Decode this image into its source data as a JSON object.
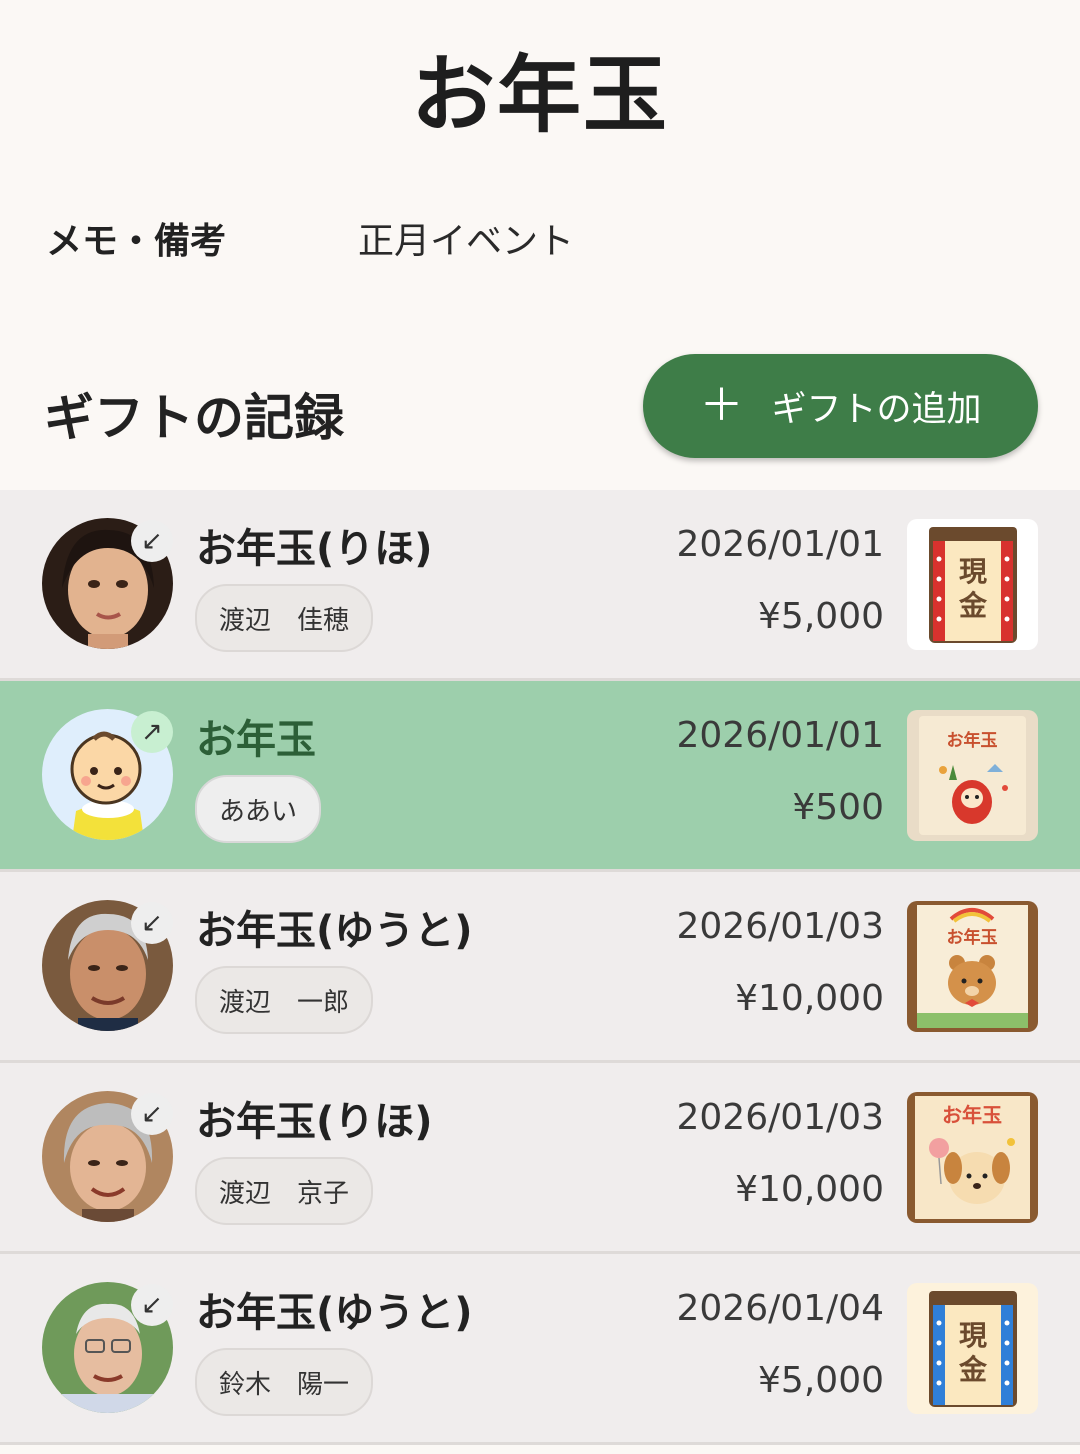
{
  "header": {
    "title": "お年玉"
  },
  "memo": {
    "label": "メモ・備考",
    "value": "正月イベント"
  },
  "gifts_section": {
    "title": "ギフトの記録",
    "add_button": {
      "icon": "plus-icon",
      "label": "ギフトの追加"
    }
  },
  "gifts": [
    {
      "title": "お年玉(りほ)",
      "person": "渡辺　佳穂",
      "date": "2026/01/01",
      "amount": "¥5,000",
      "direction": "received",
      "direction_icon": "↙",
      "selected": false,
      "thumb": "現金 envelope red"
    },
    {
      "title": "お年玉",
      "person": "ああい",
      "date": "2026/01/01",
      "amount": "¥500",
      "direction": "given",
      "direction_icon": "↗",
      "selected": true,
      "thumb": "お年玉 daruma envelope"
    },
    {
      "title": "お年玉(ゆうと)",
      "person": "渡辺　一郎",
      "date": "2026/01/03",
      "amount": "¥10,000",
      "direction": "received",
      "direction_icon": "↙",
      "selected": false,
      "thumb": "お年玉 bear envelope"
    },
    {
      "title": "お年玉(りほ)",
      "person": "渡辺　京子",
      "date": "2026/01/03",
      "amount": "¥10,000",
      "direction": "received",
      "direction_icon": "↙",
      "selected": false,
      "thumb": "お年玉 dog envelope"
    },
    {
      "title": "お年玉(ゆうと)",
      "person": "鈴木　陽一",
      "date": "2026/01/04",
      "amount": "¥5,000",
      "direction": "received",
      "direction_icon": "↙",
      "selected": false,
      "thumb": "現金 envelope blue"
    }
  ],
  "thumb_text": {
    "cash1": "現",
    "cash2": "金",
    "otoshidama": "お年玉"
  },
  "colors": {
    "accent": "#3e7d48",
    "selected_row": "#9dcfac",
    "row_bg": "#f0eded",
    "page_bg": "#fbf8f5"
  }
}
